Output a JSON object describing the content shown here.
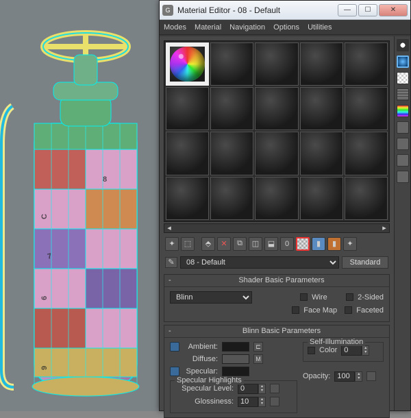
{
  "window": {
    "title": "Material Editor - 08 - Default"
  },
  "menu": {
    "modes": "Modes",
    "material": "Material",
    "navigation": "Navigation",
    "options": "Options",
    "utilities": "Utilities"
  },
  "namerow": {
    "name": "08 - Default",
    "type": "Standard"
  },
  "rollup1": {
    "title": "Shader Basic Parameters",
    "shader": "Blinn",
    "wire": "Wire",
    "twosided": "2-Sided",
    "facemap": "Face Map",
    "faceted": "Faceted"
  },
  "rollup2": {
    "title": "Blinn Basic Parameters",
    "selfillum": "Self-Illumination",
    "color": "Color",
    "colorval": "0",
    "ambient": "Ambient:",
    "diffuse": "Diffuse:",
    "specular": "Specular:",
    "m": "M",
    "opacity": "Opacity:",
    "opval": "100",
    "highlights": "Specular Highlights",
    "speclevel": "Specular Level:",
    "speclevelval": "0",
    "gloss": "Glossiness:",
    "glossval": "10"
  }
}
